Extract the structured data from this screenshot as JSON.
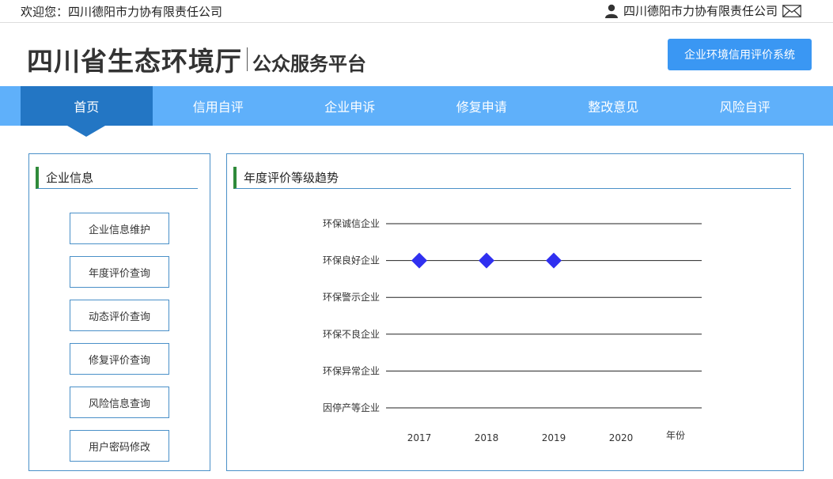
{
  "topbar": {
    "welcome_label": "欢迎您：",
    "welcome_company": "四川德阳市力协有限责任公司",
    "user_company": "四川德阳市力协有限责任公司",
    "user_icon": "user-icon",
    "mail_icon": "mail-icon"
  },
  "header": {
    "logo_main": "四川省生态环境厅",
    "logo_sub": "公众服务平台",
    "credit_button": "企业环境信用评价系统"
  },
  "nav": {
    "items": [
      {
        "label": "首页",
        "active": true
      },
      {
        "label": "信用自评"
      },
      {
        "label": "企业申诉"
      },
      {
        "label": "修复申请"
      },
      {
        "label": "整改意见"
      },
      {
        "label": "风险自评"
      }
    ]
  },
  "sidebar": {
    "title": "企业信息",
    "items": [
      "企业信息维护",
      "年度评价查询",
      "动态评价查询",
      "修复评价查询",
      "风险信息查询",
      "用户密码修改"
    ]
  },
  "main": {
    "title": "年度评价等级趋势"
  },
  "colors": {
    "nav_bg": "#5fb0fa",
    "nav_active": "#2376c4",
    "button_blue": "#3a97f3",
    "panel_border": "#4a90c8",
    "title_accent": "#2f8a3a",
    "marker": "#3030f0"
  },
  "chart_data": {
    "type": "scatter",
    "title": "",
    "xlabel": "年份",
    "ylabel": "",
    "categories": [
      "环保诚信企业",
      "环保良好企业",
      "环保警示企业",
      "环保不良企业",
      "环保异常企业",
      "因停产等企业"
    ],
    "x": [
      "2017",
      "2018",
      "2019",
      "2020"
    ],
    "series": [
      {
        "points": [
          {
            "x": "2017",
            "y": "环保良好企业"
          },
          {
            "x": "2018",
            "y": "环保良好企业"
          },
          {
            "x": "2019",
            "y": "环保良好企业"
          }
        ]
      }
    ]
  }
}
